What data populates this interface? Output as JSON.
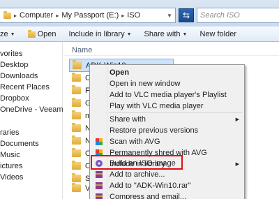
{
  "address": {
    "crumbs": [
      "Computer",
      "My Passport (E:)",
      "ISO"
    ],
    "refresh_icon": "refresh-icon",
    "search_placeholder": "Search ISO"
  },
  "toolbar": {
    "organize_label": "ze",
    "open_label": "Open",
    "include_label": "Include in library",
    "share_label": "Share with",
    "new_folder_label": "New folder"
  },
  "nav": {
    "items": [
      "vorites",
      "Desktop",
      "Downloads",
      "Recent Places",
      "Dropbox",
      "OneDrive - Veeam Soft",
      "",
      "raries",
      "Documents",
      "Music",
      "ictures",
      "Videos"
    ]
  },
  "files": {
    "column_name": "Name",
    "rows": [
      "ADK-Win10",
      "CBT",
      "Free",
      "Gam",
      "mhv",
      "Net",
      "Nim",
      "Ora",
      "Ori",
      "Serv",
      "VMw",
      "VMw"
    ]
  },
  "context_menu": {
    "items": [
      {
        "label": "Open",
        "bold": true
      },
      {
        "label": "Open in new window"
      },
      {
        "label": "Add to VLC media player's Playlist"
      },
      {
        "label": "Play with VLC media player"
      },
      {
        "label": "Share with",
        "submenu": true
      },
      {
        "label": "Restore previous versions"
      },
      {
        "label": "Scan with AVG"
      },
      {
        "label": "Permanently shred with AVG"
      },
      {
        "label": "Include in library",
        "submenu": true
      },
      {
        "label": "Build an ISO image"
      },
      {
        "label": "Add to archive..."
      },
      {
        "label": "Add to \"ADK-Win10.rar\""
      },
      {
        "label": "Compress and email..."
      }
    ]
  },
  "colors": {
    "highlight": "#e01010",
    "selection": "#cce3fb"
  }
}
